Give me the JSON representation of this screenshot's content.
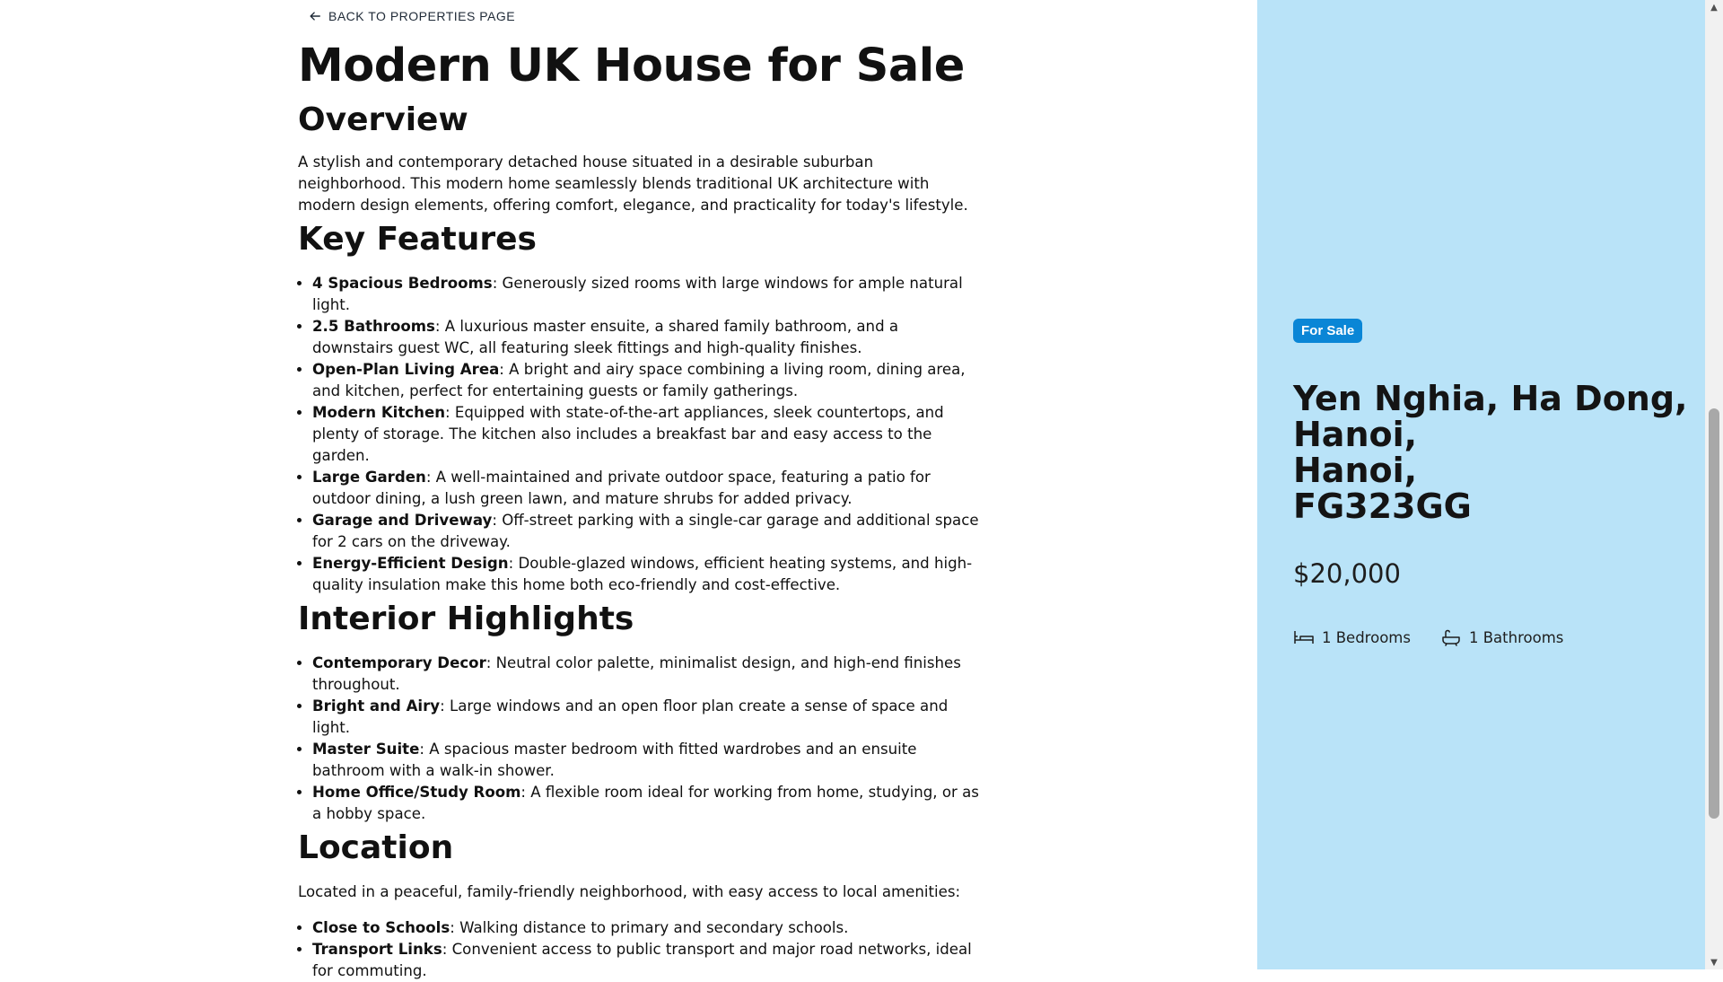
{
  "nav": {
    "back_label": "BACK TO PROPERTIES PAGE",
    "back_icon": "arrow-left-icon"
  },
  "title": "Modern UK House for Sale",
  "overview": {
    "heading": "Overview",
    "text": "A stylish and contemporary detached house situated in a desirable suburban neighborhood. This modern home seamlessly blends traditional UK architecture with modern design elements, offering comfort, elegance, and practicality for today's lifestyle."
  },
  "key_features": {
    "heading": "Key Features",
    "items": [
      {
        "term": "4 Spacious Bedrooms",
        "desc": ": Generously sized rooms with large windows for ample natural light."
      },
      {
        "term": "2.5 Bathrooms",
        "desc": ": A luxurious master ensuite, a shared family bathroom, and a downstairs guest WC, all featuring sleek fittings and high-quality finishes."
      },
      {
        "term": "Open-Plan Living Area",
        "desc": ": A bright and airy space combining a living room, dining area, and kitchen, perfect for entertaining guests or family gatherings."
      },
      {
        "term": "Modern Kitchen",
        "desc": ": Equipped with state-of-the-art appliances, sleek countertops, and plenty of storage. The kitchen also includes a breakfast bar and easy access to the garden."
      },
      {
        "term": "Large Garden",
        "desc": ": A well-maintained and private outdoor space, featuring a patio for outdoor dining, a lush green lawn, and mature shrubs for added privacy."
      },
      {
        "term": "Garage and Driveway",
        "desc": ": Off-street parking with a single-car garage and additional space for 2 cars on the driveway."
      },
      {
        "term": "Energy-Efficient Design",
        "desc": ": Double-glazed windows, efficient heating systems, and high-quality insulation make this home both eco-friendly and cost-effective."
      }
    ]
  },
  "interior": {
    "heading": "Interior Highlights",
    "items": [
      {
        "term": "Contemporary Decor",
        "desc": ": Neutral color palette, minimalist design, and high-end finishes throughout."
      },
      {
        "term": "Bright and Airy",
        "desc": ": Large windows and an open floor plan create a sense of space and light."
      },
      {
        "term": "Master Suite",
        "desc": ": A spacious master bedroom with fitted wardrobes and an ensuite bathroom with a walk-in shower."
      },
      {
        "term": "Home Office/Study Room",
        "desc": ": A flexible room ideal for working from home, studying, or as a hobby space."
      }
    ]
  },
  "location": {
    "heading": "Location",
    "intro": "Located in a peaceful, family-friendly neighborhood, with easy access to local amenities:",
    "items": [
      {
        "term": "Close to Schools",
        "desc": ": Walking distance to primary and secondary schools."
      },
      {
        "term": "Transport Links",
        "desc": ": Convenient access to public transport and major road networks, ideal for commuting."
      }
    ]
  },
  "sidebar": {
    "status": "For Sale",
    "address_lines": [
      "Yen Nghia, Ha Dong,",
      "Hanoi,",
      "Hanoi,",
      "FG323GG"
    ],
    "price": "$20,000",
    "bedrooms": "1 Bedrooms",
    "bathrooms": "1 Bathrooms",
    "bed_icon": "bed-icon",
    "bath_icon": "bathtub-icon"
  },
  "colors": {
    "sidebar_bg": "#b9e3f8",
    "badge_bg": "#0a86d6"
  }
}
